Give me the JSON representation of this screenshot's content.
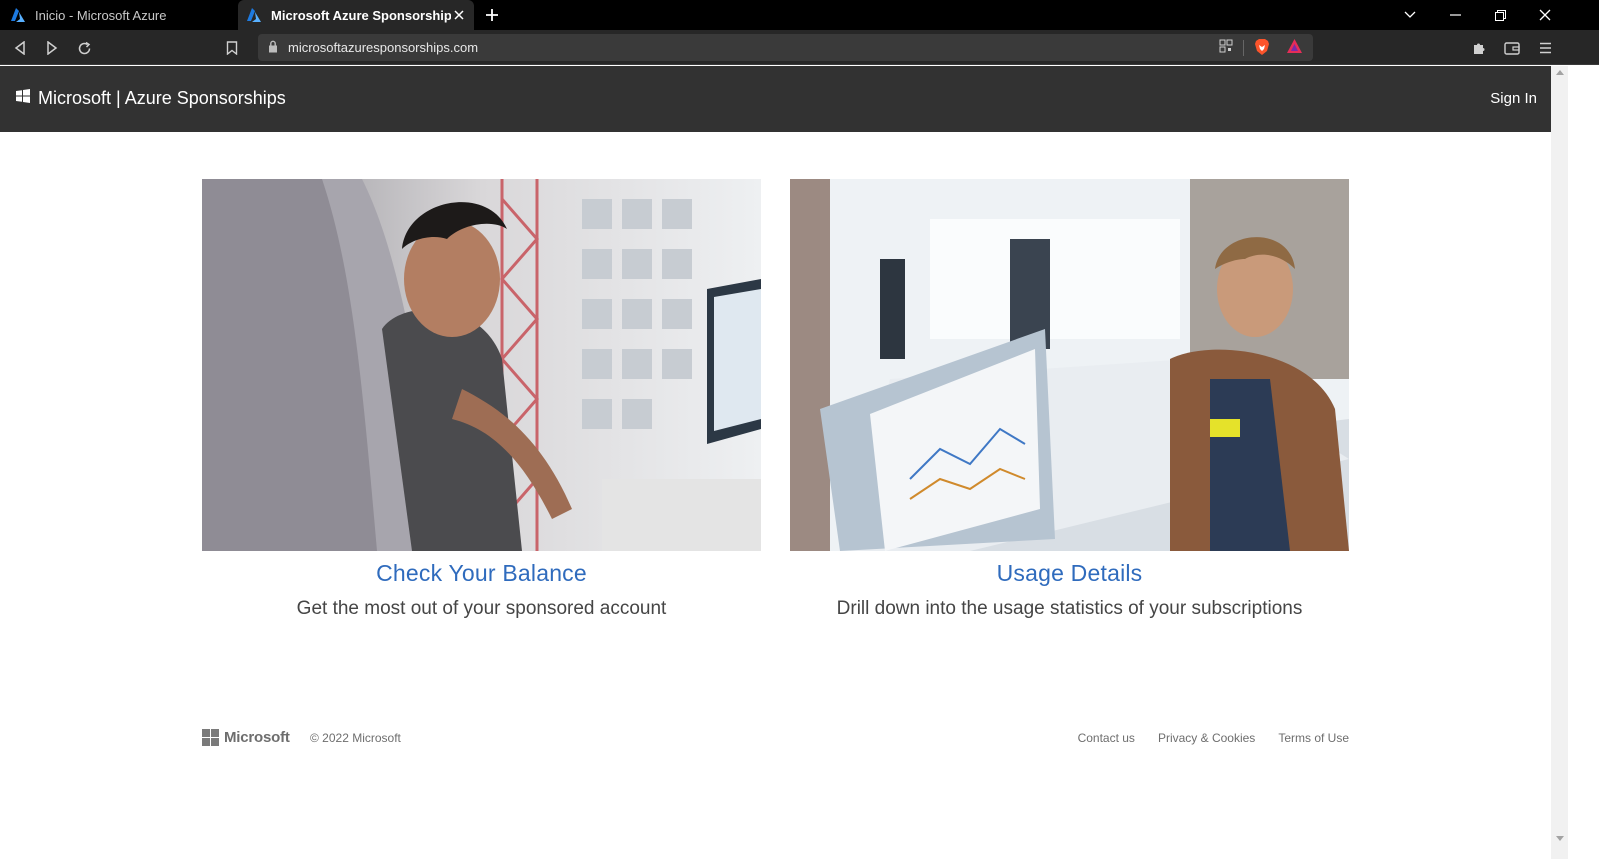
{
  "browser": {
    "tabs": [
      {
        "title": "Inicio - Microsoft Azure",
        "active": false
      },
      {
        "title": "Microsoft Azure Sponsorships | W",
        "active": true
      }
    ],
    "url": "microsoftazuresponsorships.com"
  },
  "site": {
    "brand": "Microsoft | Azure Sponsorships",
    "signin_label": "Sign In"
  },
  "cards": [
    {
      "title": "Check Your Balance",
      "description": "Get the most out of your sponsored account"
    },
    {
      "title": "Usage Details",
      "description": "Drill down into the usage statistics of your subscriptions"
    }
  ],
  "footer": {
    "logo_text": "Microsoft",
    "copyright": "© 2022 Microsoft",
    "links": [
      "Contact us",
      "Privacy & Cookies",
      "Terms of Use"
    ]
  },
  "colors": {
    "header_bg": "#323232",
    "link_blue": "#2f6bbd",
    "azure_blue": "#1d7ae0",
    "brave_orange": "#fb542b"
  }
}
